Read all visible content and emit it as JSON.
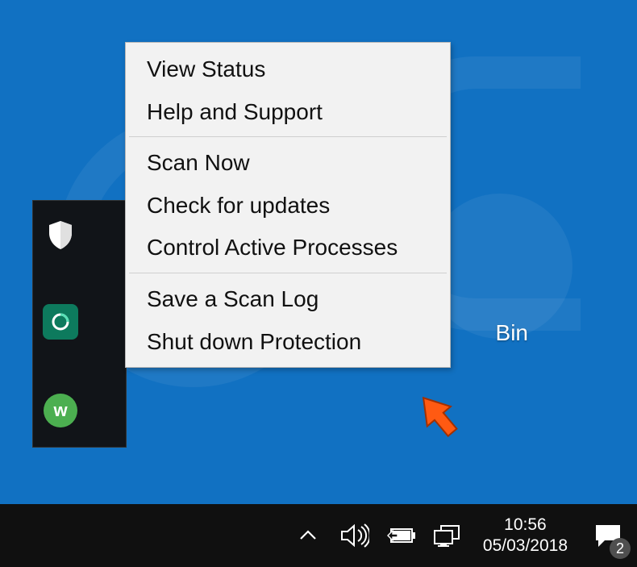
{
  "menu": {
    "group1": [
      "View Status",
      "Help and Support"
    ],
    "group2": [
      "Scan Now",
      "Check for updates",
      "Control Active Processes"
    ],
    "group3": [
      "Save a Scan Log",
      "Shut down Protection"
    ]
  },
  "desktop": {
    "bin_label": "Bin"
  },
  "taskbar": {
    "time": "10:56",
    "date": "05/03/2018",
    "notification_count": "2"
  }
}
